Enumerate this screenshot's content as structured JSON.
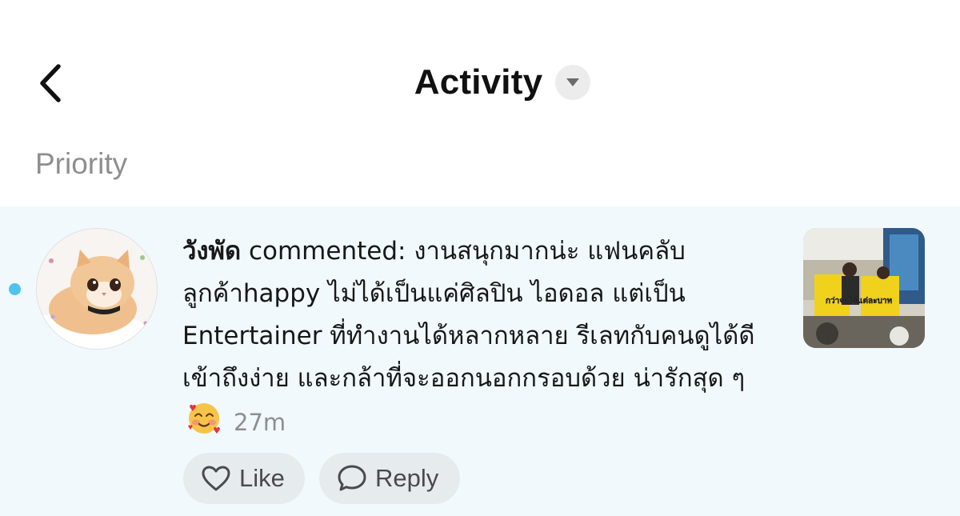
{
  "header": {
    "title": "Activity",
    "back_icon": "chevron-left-icon",
    "dropdown_icon": "caret-down-icon"
  },
  "section": {
    "label": "Priority"
  },
  "notification": {
    "username": "วังพัด",
    "action": " commented: ",
    "comment": "งานสนุกมากน่ะ แฟนคลับลูกค้าhappy ไม่ได้เป็นแค่ศิลปิน ไอดอล แต่เป็น Entertainer ที่ทำงานได้หลากหลาย รีเลทกับคนดูได้ดี เข้าถึงง่าย และกล้าที่จะออกนอกกรอบด้วย น่ารักสุด ๆ",
    "emoji": "smiling-face-with-hearts",
    "time": "27m",
    "unread": true,
    "thumbnail_caption": "กว่าจะได้แต่ละบาท",
    "actions": {
      "like_label": "Like",
      "reply_label": "Reply"
    }
  },
  "colors": {
    "accent_dot": "#4dc3ee",
    "row_background": "#f1f9fd",
    "muted_text": "#8e8e8e",
    "pill_background": "#e6ebee"
  }
}
